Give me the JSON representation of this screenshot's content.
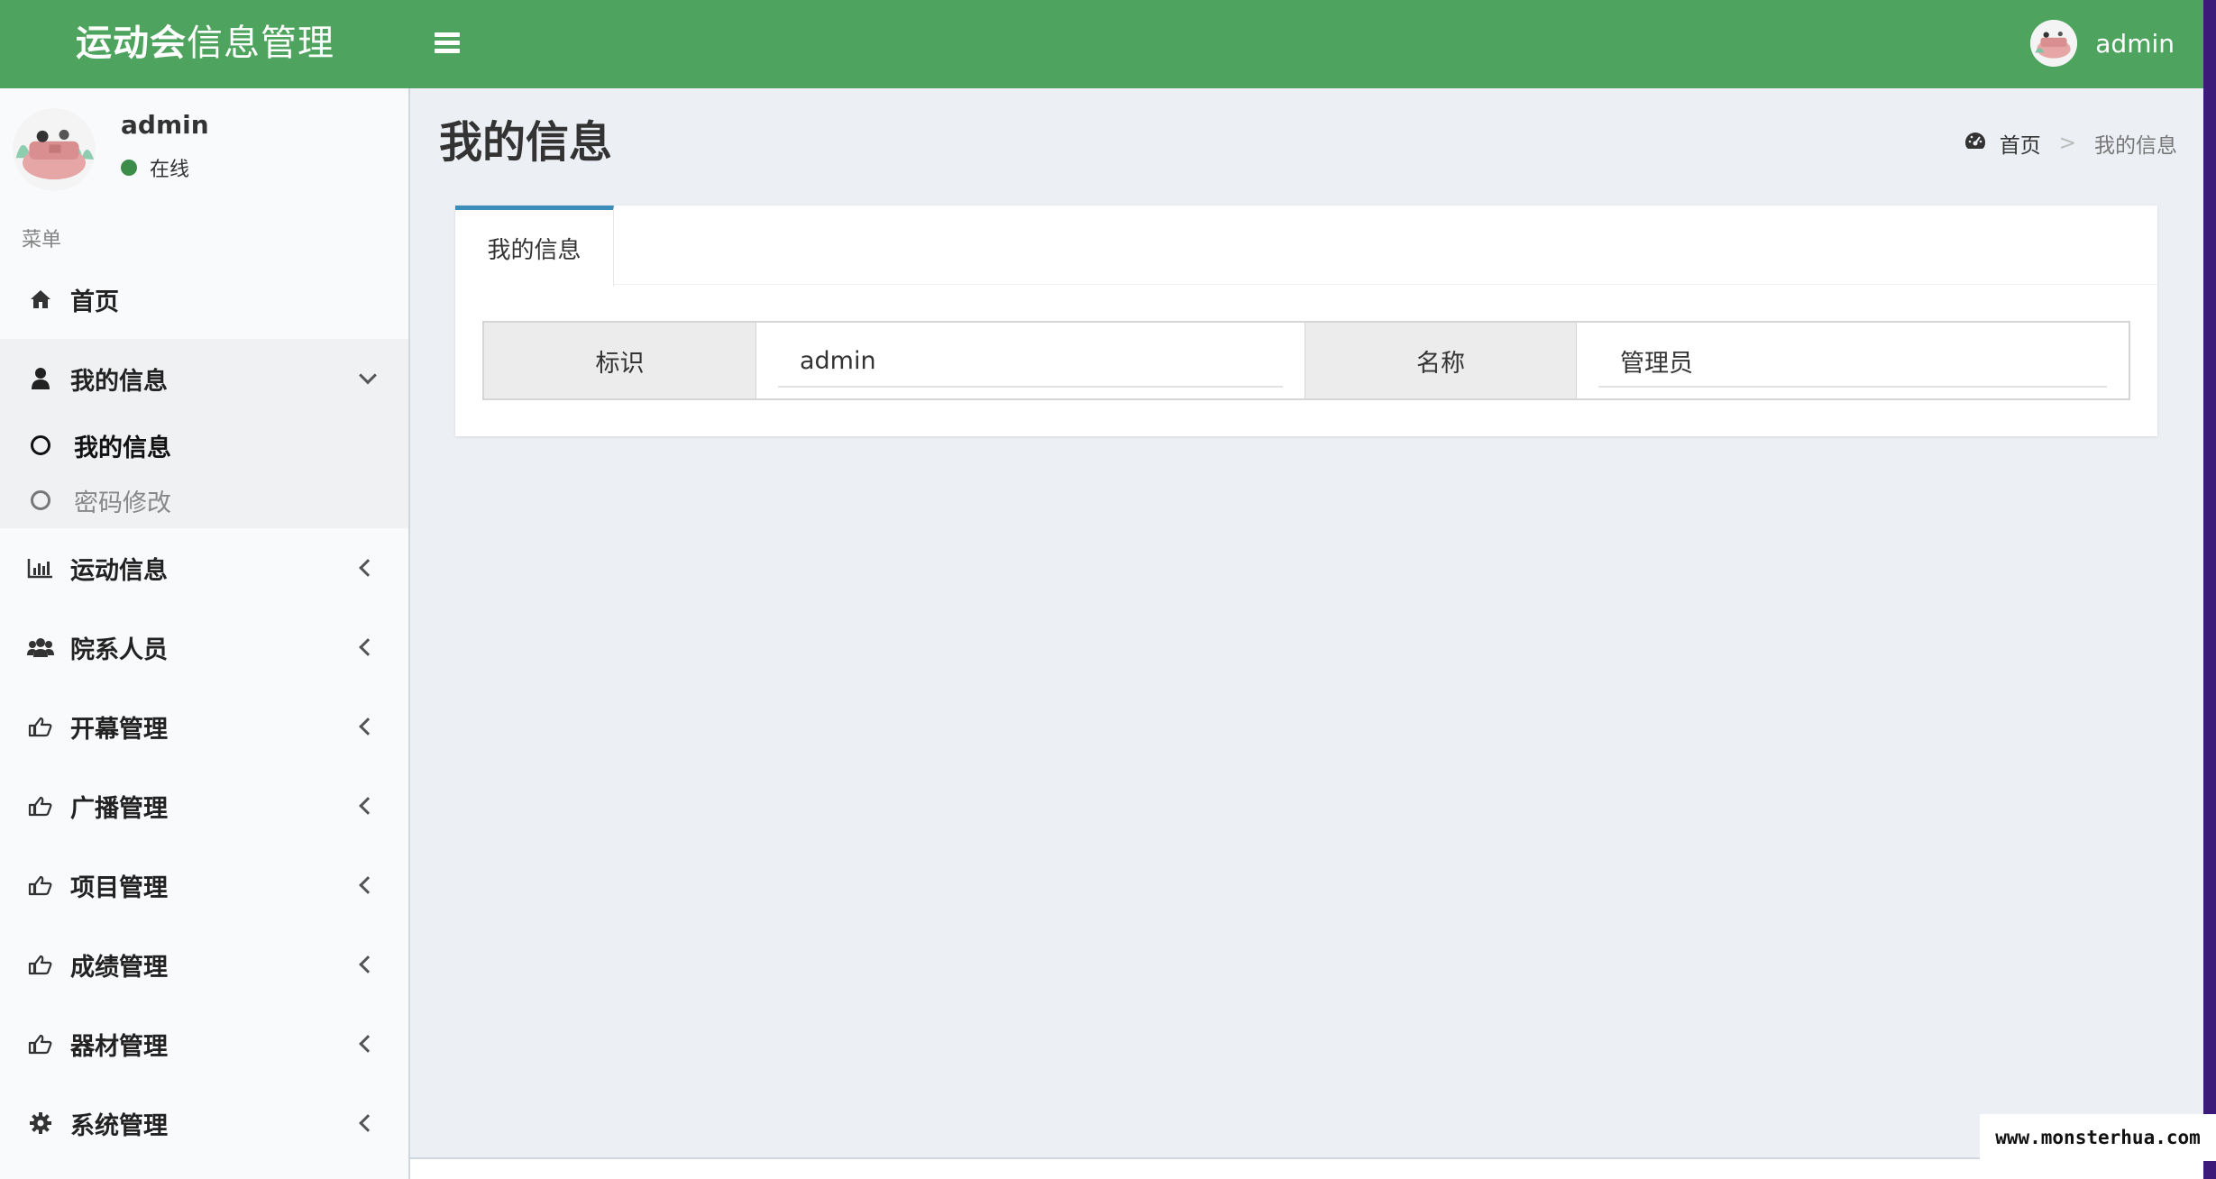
{
  "header": {
    "logo_bold": "运动会",
    "logo_normal": "信息管理",
    "username": "admin"
  },
  "sidebar": {
    "user": {
      "name": "admin",
      "status": "在线"
    },
    "menu_header": "菜单",
    "items": [
      {
        "label": "首页",
        "icon": "home-icon"
      },
      {
        "label": "我的信息",
        "icon": "user-icon",
        "expanded": true,
        "children": [
          {
            "label": "我的信息",
            "active": true
          },
          {
            "label": "密码修改",
            "active": false
          }
        ]
      },
      {
        "label": "运动信息",
        "icon": "bar-chart-icon"
      },
      {
        "label": "院系人员",
        "icon": "users-icon"
      },
      {
        "label": "开幕管理",
        "icon": "thumbs-up-icon"
      },
      {
        "label": "广播管理",
        "icon": "thumbs-up-icon"
      },
      {
        "label": "项目管理",
        "icon": "thumbs-up-icon"
      },
      {
        "label": "成绩管理",
        "icon": "thumbs-up-icon"
      },
      {
        "label": "器材管理",
        "icon": "thumbs-up-icon"
      },
      {
        "label": "系统管理",
        "icon": "gear-icon"
      }
    ]
  },
  "main": {
    "page_title": "我的信息",
    "breadcrumb": {
      "home": "首页",
      "current": "我的信息",
      "separator": ">"
    },
    "tab_label": "我的信息",
    "fields": [
      {
        "label": "标识",
        "value": "admin"
      },
      {
        "label": "名称",
        "value": "管理员"
      }
    ]
  },
  "watermark": "www.monsterhua.com",
  "colors": {
    "header_bg": "#4ea45e",
    "sidebar_bg": "#f9fafc",
    "content_bg": "#ecf0f5",
    "tab_accent": "#3c8dbc",
    "online_dot": "#3c8d4a"
  }
}
